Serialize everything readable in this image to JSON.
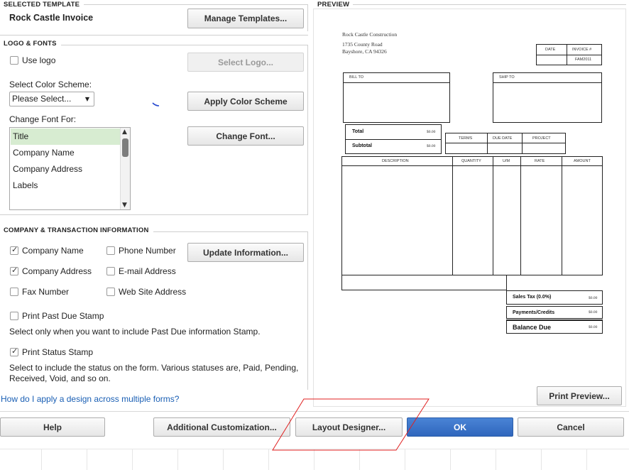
{
  "selected_template": {
    "section_title": "SELECTED TEMPLATE",
    "template_name": "Rock Castle Invoice",
    "manage_button": "Manage Templates..."
  },
  "logo_fonts": {
    "section_title": "LOGO & FONTS",
    "use_logo_label": "Use logo",
    "use_logo_checked": false,
    "select_logo_button": "Select Logo...",
    "color_scheme_label": "Select Color Scheme:",
    "color_scheme_value": "Please Select...",
    "apply_color_button": "Apply Color Scheme",
    "change_font_for_label": "Change Font For:",
    "font_items": [
      "Title",
      "Company Name",
      "Company Address",
      "Labels"
    ],
    "selected_font_item": "Title",
    "change_font_button": "Change Font..."
  },
  "company_info": {
    "section_title": "COMPANY & TRANSACTION INFORMATION",
    "company_name_label": "Company Name",
    "company_name_checked": true,
    "phone_label": "Phone Number",
    "phone_checked": false,
    "update_button": "Update Information...",
    "company_address_label": "Company Address",
    "company_address_checked": true,
    "email_label": "E-mail Address",
    "email_checked": false,
    "fax_label": "Fax Number",
    "fax_checked": false,
    "website_label": "Web Site Address",
    "website_checked": false,
    "past_due_label": "Print Past Due Stamp",
    "past_due_checked": false,
    "past_due_help": "Select only when you want to include Past Due information Stamp.",
    "status_stamp_label": "Print Status Stamp",
    "status_stamp_checked": true,
    "status_help_1": "Select to include the status on the form. Various statuses are, Paid, Pending,",
    "status_help_2": "Received, Void, and so on."
  },
  "help_link": "How do I apply a design across multiple forms?",
  "preview": {
    "section_title": "PREVIEW",
    "company_name": "Rock Castle Construction",
    "address_1": "1735 County Road",
    "address_2": "Bayshore, CA 94326",
    "date_header": "DATE",
    "invoice_header": "INVOICE #",
    "invoice_value": "FAM2011",
    "bill_to": "BILL TO",
    "ship_to": "SHIP TO",
    "total_label": "Total",
    "total_value": "$0.00",
    "subtotal_label": "Subtotal",
    "subtotal_value": "$0.00",
    "terms_header": "TERMS",
    "due_date_header": "DUE DATE",
    "project_header": "PROJECT",
    "columns": [
      "DESCRIPTION",
      "QUANTITY",
      "U/M",
      "RATE",
      "AMOUNT"
    ],
    "sales_tax_label": "Sales Tax  (0.0%)",
    "sales_tax_value": "$0.00",
    "payments_label": "Payments/Credits",
    "payments_value": "$0.00",
    "balance_label": "Balance Due",
    "balance_value": "$0.00",
    "print_preview_button": "Print Preview..."
  },
  "footer": {
    "help_button": "Help",
    "additional_button": "Additional Customization...",
    "layout_button": "Layout Designer...",
    "ok_button": "OK",
    "cancel_button": "Cancel"
  },
  "colors": {
    "primary_button": "#2f66bd",
    "selected_list_item": "#d7ecd1",
    "link": "#1a5fb4",
    "annotation": "#e02020"
  }
}
